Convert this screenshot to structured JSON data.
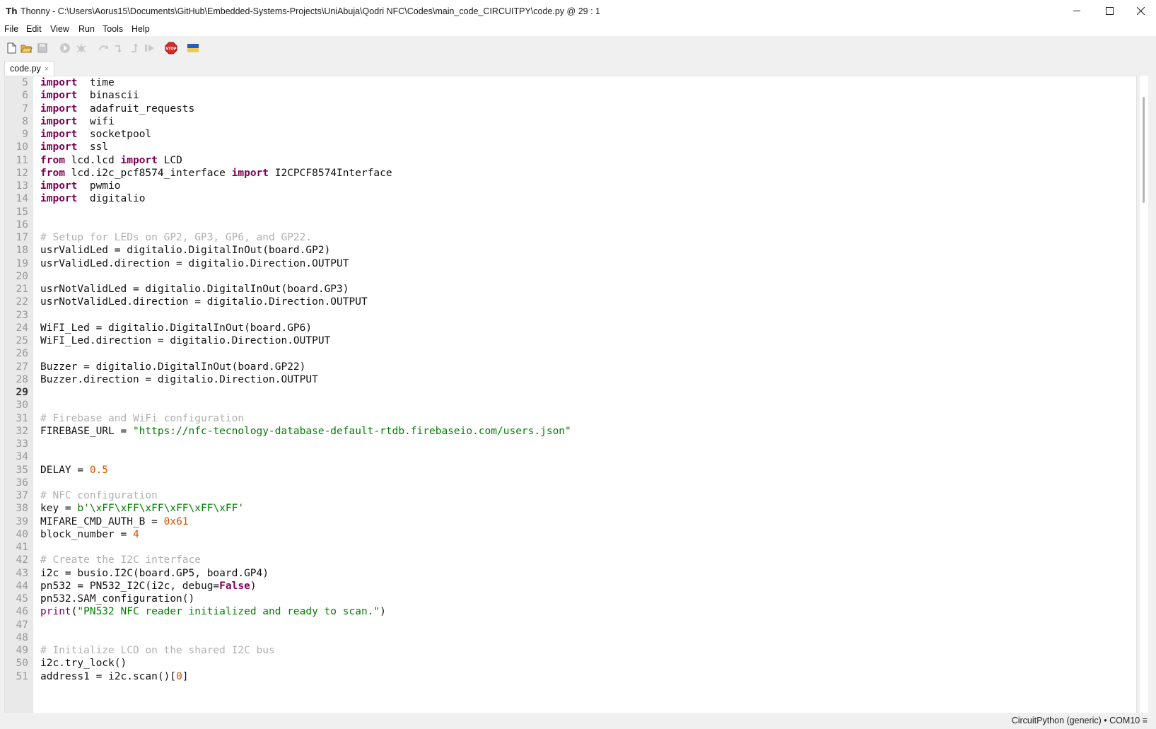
{
  "window": {
    "title": "Thonny  -  C:\\Users\\Aorus15\\Documents\\GitHub\\Embedded-Systems-Projects\\UniAbuja\\Qodri NFC\\Codes\\main_code_CIRCUITPY\\code.py  @  29 : 1",
    "app_icon_glyph": "Th"
  },
  "menu": [
    "File",
    "Edit",
    "View",
    "Run",
    "Tools",
    "Help"
  ],
  "toolbar": {
    "icons": [
      "new-file-icon",
      "open-file-icon",
      "save-icon",
      "run-icon",
      "debug-icon",
      "step-over-icon",
      "step-into-icon",
      "step-out-icon",
      "resume-icon",
      "stop-icon",
      "ukraine-flag-icon"
    ],
    "stop_label": "STOP"
  },
  "editor": {
    "tab": {
      "label": "code.py",
      "close": "×"
    },
    "current_line": 29,
    "lines": [
      {
        "n": "5",
        "t": [
          [
            "kw",
            "import"
          ],
          [
            "",
            "  time"
          ]
        ]
      },
      {
        "n": "6",
        "t": [
          [
            "kw",
            "import"
          ],
          [
            "",
            "  binascii"
          ]
        ]
      },
      {
        "n": "7",
        "t": [
          [
            "kw",
            "import"
          ],
          [
            "",
            "  adafruit_requests"
          ]
        ]
      },
      {
        "n": "8",
        "t": [
          [
            "kw",
            "import"
          ],
          [
            "",
            "  wifi"
          ]
        ]
      },
      {
        "n": "9",
        "t": [
          [
            "kw",
            "import"
          ],
          [
            "",
            "  socketpool"
          ]
        ]
      },
      {
        "n": "10",
        "t": [
          [
            "kw",
            "import"
          ],
          [
            "",
            "  ssl"
          ]
        ]
      },
      {
        "n": "11",
        "t": [
          [
            "kw",
            "from"
          ],
          [
            "",
            " lcd.lcd "
          ],
          [
            "kw",
            "import"
          ],
          [
            "",
            " LCD"
          ]
        ]
      },
      {
        "n": "12",
        "t": [
          [
            "kw",
            "from"
          ],
          [
            "",
            " lcd.i2c_pcf8574_interface "
          ],
          [
            "kw",
            "import"
          ],
          [
            "",
            " I2CPCF8574Interface"
          ]
        ]
      },
      {
        "n": "13",
        "t": [
          [
            "kw",
            "import"
          ],
          [
            "",
            "  pwmio"
          ]
        ]
      },
      {
        "n": "14",
        "t": [
          [
            "kw",
            "import"
          ],
          [
            "",
            "  digitalio"
          ]
        ]
      },
      {
        "n": "15",
        "t": []
      },
      {
        "n": "16",
        "t": []
      },
      {
        "n": "17",
        "t": [
          [
            "cm",
            "# Setup for LEDs on GP2, GP3, GP6, and GP22."
          ]
        ]
      },
      {
        "n": "18",
        "t": [
          [
            "",
            "usrValidLed = digitalio.DigitalInOut(board.GP2)"
          ]
        ]
      },
      {
        "n": "19",
        "t": [
          [
            "",
            "usrValidLed.direction = digitalio.Direction.OUTPUT"
          ]
        ]
      },
      {
        "n": "20",
        "t": []
      },
      {
        "n": "21",
        "t": [
          [
            "",
            "usrNotValidLed = digitalio.DigitalInOut(board.GP3)"
          ]
        ]
      },
      {
        "n": "22",
        "t": [
          [
            "",
            "usrNotValidLed.direction = digitalio.Direction.OUTPUT"
          ]
        ]
      },
      {
        "n": "23",
        "t": []
      },
      {
        "n": "24",
        "t": [
          [
            "",
            "WiFI_Led = digitalio.DigitalInOut(board.GP6)"
          ]
        ]
      },
      {
        "n": "25",
        "t": [
          [
            "",
            "WiFI_Led.direction = digitalio.Direction.OUTPUT"
          ]
        ]
      },
      {
        "n": "26",
        "t": []
      },
      {
        "n": "27",
        "t": [
          [
            "",
            "Buzzer = digitalio.DigitalInOut(board.GP22)"
          ]
        ]
      },
      {
        "n": "28",
        "t": [
          [
            "",
            "Buzzer.direction = digitalio.Direction.OUTPUT"
          ]
        ]
      },
      {
        "n": "29",
        "t": []
      },
      {
        "n": "30",
        "t": []
      },
      {
        "n": "31",
        "t": [
          [
            "cm",
            "# Firebase and WiFi configuration"
          ]
        ]
      },
      {
        "n": "32",
        "t": [
          [
            "",
            "FIREBASE_URL = "
          ],
          [
            "str",
            "\"https://nfc-tecnology-database-default-rtdb.firebaseio.com/users.json\""
          ]
        ]
      },
      {
        "n": "33",
        "t": []
      },
      {
        "n": "34",
        "t": []
      },
      {
        "n": "35",
        "t": [
          [
            "",
            "DELAY = "
          ],
          [
            "num",
            "0.5"
          ]
        ]
      },
      {
        "n": "36",
        "t": []
      },
      {
        "n": "37",
        "t": [
          [
            "cm",
            "# NFC configuration"
          ]
        ]
      },
      {
        "n": "38",
        "t": [
          [
            "",
            "key = "
          ],
          [
            "str",
            "b'\\xFF\\xFF\\xFF\\xFF\\xFF\\xFF'"
          ]
        ]
      },
      {
        "n": "39",
        "t": [
          [
            "",
            "MIFARE_CMD_AUTH_B = "
          ],
          [
            "num",
            "0x61"
          ]
        ]
      },
      {
        "n": "40",
        "t": [
          [
            "",
            "block_number = "
          ],
          [
            "num",
            "4"
          ]
        ]
      },
      {
        "n": "41",
        "t": []
      },
      {
        "n": "42",
        "t": [
          [
            "cm",
            "# Create the I2C interface"
          ]
        ]
      },
      {
        "n": "43",
        "t": [
          [
            "",
            "i2c = busio.I2C(board.GP5, board.GP4)"
          ]
        ]
      },
      {
        "n": "44",
        "t": [
          [
            "",
            "pn532 = PN532_I2C(i2c, debug="
          ],
          [
            "kw2",
            "False"
          ],
          [
            "",
            ")"
          ]
        ]
      },
      {
        "n": "45",
        "t": [
          [
            "",
            "pn532.SAM_configuration()"
          ]
        ]
      },
      {
        "n": "46",
        "t": [
          [
            "bi",
            "print"
          ],
          [
            "",
            "("
          ],
          [
            "str",
            "\"PN532 NFC reader initialized and ready to scan.\""
          ],
          [
            "",
            ")"
          ]
        ]
      },
      {
        "n": "47",
        "t": []
      },
      {
        "n": "48",
        "t": []
      },
      {
        "n": "49",
        "t": [
          [
            "cm",
            "# Initialize LCD on the shared I2C bus"
          ]
        ]
      },
      {
        "n": "50",
        "t": [
          [
            "",
            "i2c.try_lock()"
          ]
        ]
      },
      {
        "n": "51",
        "t": [
          [
            "",
            "address1 = i2c.scan()["
          ],
          [
            "num",
            "0"
          ],
          [
            "",
            "]"
          ]
        ]
      }
    ]
  },
  "status": {
    "text": "CircuitPython (generic)  •  COM10  ≡"
  }
}
